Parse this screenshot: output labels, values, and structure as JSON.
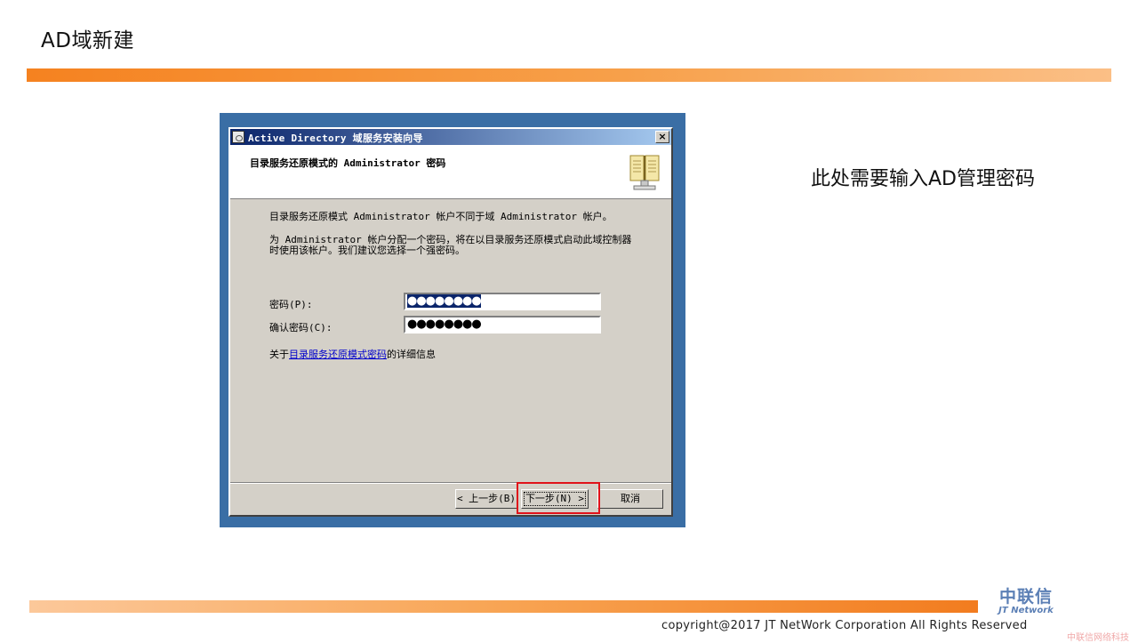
{
  "slide": {
    "title": "AD域新建",
    "note": "此处需要输入AD管理密码",
    "copyright": "copyright@2017  JT NetWork Corporation All Rights Reserved",
    "logo_main": "中联信",
    "logo_sub": "JT Network",
    "watermark": "中联信网络科技"
  },
  "window": {
    "title": "Active Directory 域服务安装向导",
    "close_glyph": "×",
    "header_title": "目录服务还原模式的 Administrator 密码",
    "para1": "目录服务还原模式 Administrator 帐户不同于域 Administrator 帐户。",
    "para2": "为 Administrator 帐户分配一个密码，将在以目录服务还原模式启动此域控制器时使用该帐户。我们建议您选择一个强密码。",
    "password_label": "密码(P):",
    "password_value": "●●●●●●●●",
    "confirm_label": "确认密码(C):",
    "confirm_value": "●●●●●●●●",
    "link_prefix": "关于",
    "link_text": "目录服务还原模式密码",
    "link_suffix": "的详细信息",
    "buttons": {
      "back": "< 上一步(B)",
      "next": "下一步(N) >",
      "cancel": "取消"
    }
  },
  "colors": {
    "accent_orange": "#f58220",
    "titlebar_blue": "#0a246a",
    "highlight_red": "#e0121a",
    "link_blue": "#0000cc"
  }
}
